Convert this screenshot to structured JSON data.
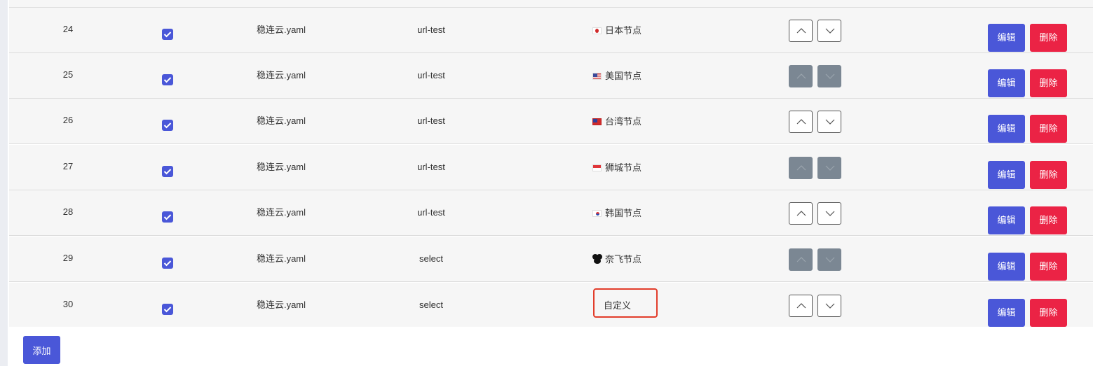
{
  "actions": {
    "edit_label": "编辑",
    "delete_label": "删除",
    "add_label": "添加"
  },
  "rows": [
    {
      "id": "24",
      "checked": true,
      "file": "稳连云.yaml",
      "type": "url-test",
      "name": "日本节点",
      "icon": "flag-japan-icon",
      "arrows_enabled": true
    },
    {
      "id": "25",
      "checked": true,
      "file": "稳连云.yaml",
      "type": "url-test",
      "name": "美国节点",
      "icon": "flag-usa-icon",
      "arrows_enabled": false
    },
    {
      "id": "26",
      "checked": true,
      "file": "稳连云.yaml",
      "type": "url-test",
      "name": "台湾节点",
      "icon": "flag-taiwan-icon",
      "arrows_enabled": true
    },
    {
      "id": "27",
      "checked": true,
      "file": "稳连云.yaml",
      "type": "url-test",
      "name": "狮城节点",
      "icon": "flag-singapore-icon",
      "arrows_enabled": false
    },
    {
      "id": "28",
      "checked": true,
      "file": "稳连云.yaml",
      "type": "url-test",
      "name": "韩国节点",
      "icon": "flag-korea-icon",
      "arrows_enabled": true
    },
    {
      "id": "29",
      "checked": true,
      "file": "稳连云.yaml",
      "type": "select",
      "name": "奈飞节点",
      "icon": "film-camera-icon",
      "arrows_enabled": false
    },
    {
      "id": "30",
      "checked": true,
      "file": "稳连云.yaml",
      "type": "select",
      "name": "自定义",
      "icon": "",
      "arrows_enabled": true,
      "highlighted": true
    }
  ],
  "colors": {
    "primary": "#4a57d8",
    "danger": "#eb2345",
    "disabled_arrow": "#7b8793",
    "highlight": "#e23d2b"
  }
}
